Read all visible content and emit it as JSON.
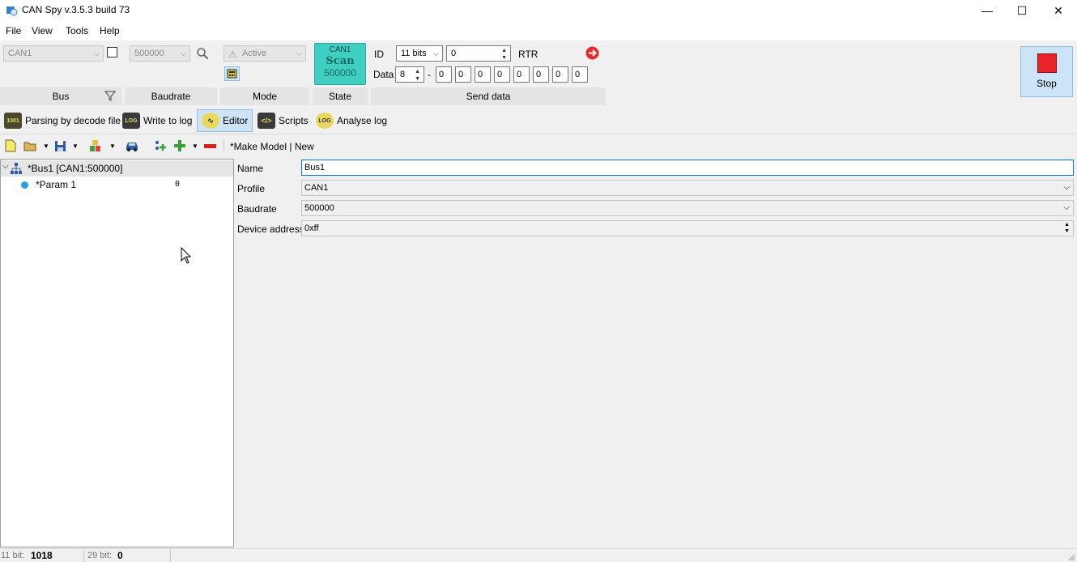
{
  "window": {
    "title": "CAN Spy v.3.5.3 build 73",
    "controls": {
      "minimize": "—",
      "maximize": "☐",
      "close": "✕"
    }
  },
  "menu": [
    "File",
    "View",
    "Tools",
    "Help"
  ],
  "ribbon": {
    "bus": {
      "value": "CAN1",
      "label": "Bus"
    },
    "baudrate": {
      "value": "500000",
      "label": "Baudrate"
    },
    "mode": {
      "value": "Active",
      "label": "Mode"
    },
    "state": {
      "line1": "CAN1",
      "line2": "Scan",
      "line3": "500000",
      "label": "State"
    },
    "send": {
      "id_label": "ID",
      "id_bits": "11 bits",
      "id_value": "0",
      "rtr_label": "RTR",
      "data_label": "Data",
      "data_len": "8",
      "dash": "-",
      "bytes": [
        "0",
        "0",
        "0",
        "0",
        "0",
        "0",
        "0",
        "0"
      ],
      "label": "Send data"
    },
    "stop": {
      "label": "Stop"
    }
  },
  "toolbar2": {
    "parsing": "Parsing by decode file",
    "write_log": "Write to log",
    "editor": "Editor",
    "scripts": "Scripts",
    "analyse_log": "Analyse log"
  },
  "editor_toolbar": {
    "model_name": "*Make Model | New"
  },
  "tree": {
    "root": "*Bus1 [CAN1:500000]",
    "child": {
      "label": "*Param 1",
      "value": "0"
    }
  },
  "form": {
    "name": {
      "label": "Name",
      "value": "Bus1"
    },
    "profile": {
      "label": "Profile",
      "value": "CAN1"
    },
    "baudrate": {
      "label": "Baudrate",
      "value": "500000"
    },
    "device_address": {
      "label": "Device address",
      "value": "0xff"
    }
  },
  "status": {
    "bit11_label": "11 bit:",
    "bit11_value": "1018",
    "bit29_label": "29 bit:",
    "bit29_value": "0"
  }
}
